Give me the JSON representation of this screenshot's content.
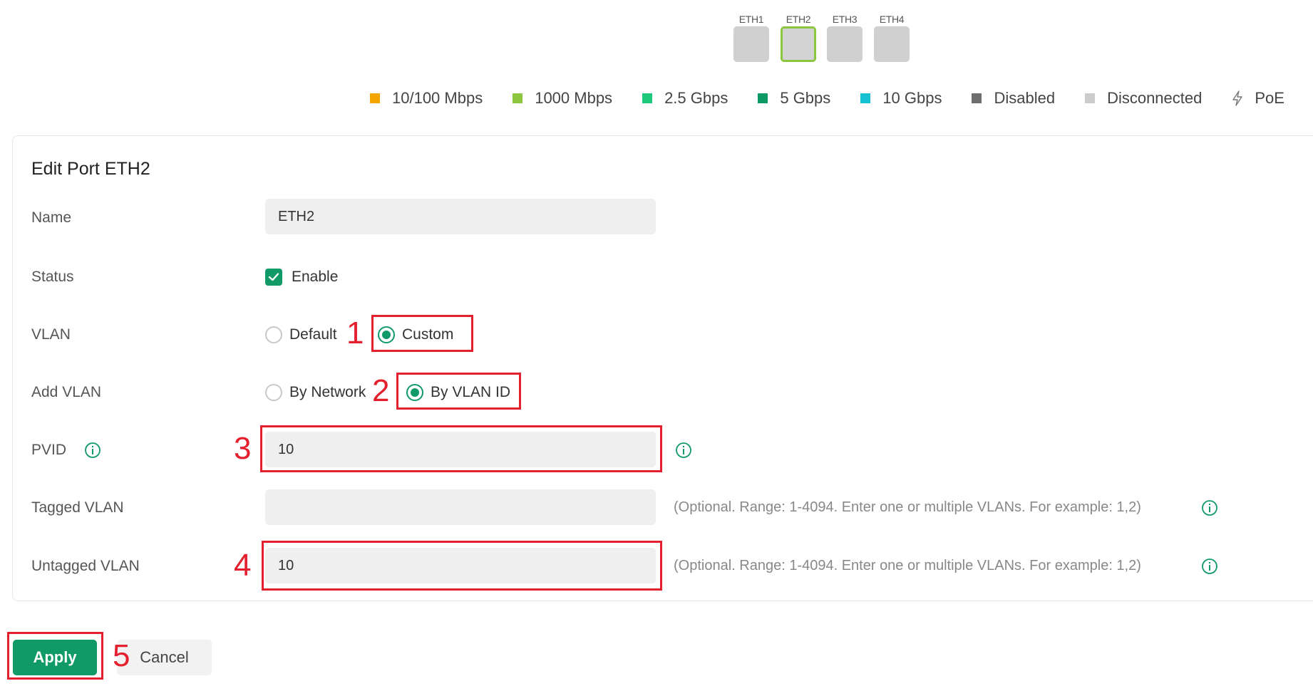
{
  "ports": [
    {
      "label": "ETH1",
      "selected": false
    },
    {
      "label": "ETH2",
      "selected": true
    },
    {
      "label": "ETH3",
      "selected": false
    },
    {
      "label": "ETH4",
      "selected": false
    }
  ],
  "legend": [
    {
      "label": "10/100 Mbps",
      "color": "#f5a500"
    },
    {
      "label": "1000 Mbps",
      "color": "#8cc63f"
    },
    {
      "label": "2.5 Gbps",
      "color": "#1fc97b"
    },
    {
      "label": "5 Gbps",
      "color": "#0c9a64"
    },
    {
      "label": "10 Gbps",
      "color": "#16c1d4"
    },
    {
      "label": "Disabled",
      "color": "#6e6e6e"
    },
    {
      "label": "Disconnected",
      "color": "#cccccc"
    },
    {
      "label": "PoE",
      "icon": "lightning-icon"
    }
  ],
  "panel": {
    "title": "Edit Port ETH2",
    "name": {
      "label": "Name",
      "value": "ETH2"
    },
    "status": {
      "label": "Status",
      "option": "Enable",
      "checked": true
    },
    "vlan": {
      "label": "VLAN",
      "options": [
        "Default",
        "Custom"
      ],
      "selected": "Custom"
    },
    "add_vlan": {
      "label": "Add VLAN",
      "options": [
        "By Network",
        "By VLAN ID"
      ],
      "selected": "By VLAN ID"
    },
    "pvid": {
      "label": "PVID",
      "value": "10"
    },
    "tagged_vlan": {
      "label": "Tagged VLAN",
      "value": "",
      "hint": "(Optional. Range: 1-4094. Enter one or multiple VLANs. For example: 1,2)"
    },
    "untagged_vlan": {
      "label": "Untagged VLAN",
      "value": "10",
      "hint": "(Optional. Range: 1-4094. Enter one or multiple VLANs. For example: 1,2)"
    }
  },
  "buttons": {
    "apply": "Apply",
    "cancel": "Cancel"
  },
  "annotations": [
    "1",
    "2",
    "3",
    "4",
    "5"
  ],
  "colors": {
    "accent": "#109a68",
    "annotation": "#e5202e",
    "selected_port": "#8cc63f"
  }
}
